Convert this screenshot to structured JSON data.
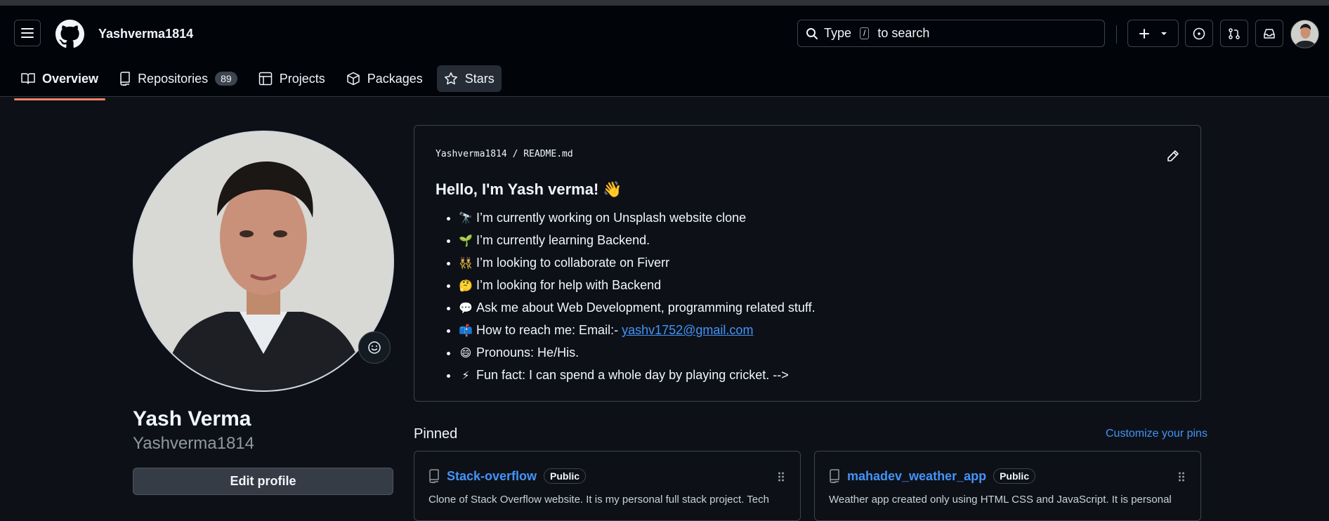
{
  "header": {
    "username": "Yashverma1814",
    "search": {
      "prefix": "Type",
      "key": "/",
      "suffix": "to search"
    }
  },
  "nav": {
    "tabs": [
      {
        "label": "Overview",
        "icon": "book-icon"
      },
      {
        "label": "Repositories",
        "icon": "repo-icon",
        "count": "89"
      },
      {
        "label": "Projects",
        "icon": "table-icon"
      },
      {
        "label": "Packages",
        "icon": "package-icon"
      },
      {
        "label": "Stars",
        "icon": "star-icon"
      }
    ]
  },
  "profile": {
    "full_name": "Yash Verma",
    "login": "Yashverma1814",
    "edit_label": "Edit profile"
  },
  "readme": {
    "path_user": "Yashverma1814",
    "path_sep": "/",
    "path_file": "README.md",
    "heading": "Hello, I'm Yash verma! 👋",
    "items": [
      {
        "emoji": "🔭",
        "text": "I’m currently working on Unsplash website clone"
      },
      {
        "emoji": "🌱",
        "text": "I’m currently learning Backend."
      },
      {
        "emoji": "👯",
        "text": "I’m looking to collaborate on Fiverr"
      },
      {
        "emoji": "🤔",
        "text": "I’m looking for help with Backend"
      },
      {
        "emoji": "💬",
        "text": "Ask me about Web Development, programming related stuff."
      },
      {
        "emoji": "📫",
        "text": "How to reach me: Email:-",
        "link": "yashv1752@gmail.com"
      },
      {
        "emoji": "😄",
        "text": "Pronouns: He/His."
      },
      {
        "emoji": "⚡",
        "text": "Fun fact: I can spend a whole day by playing cricket. -->"
      }
    ]
  },
  "pinned": {
    "title": "Pinned",
    "customize": "Customize your pins",
    "repos": [
      {
        "name": "Stack-overflow",
        "visibility": "Public",
        "description": "Clone of Stack Overflow website. It is my personal full stack project. Tech"
      },
      {
        "name": "mahadev_weather_app",
        "visibility": "Public",
        "description": "Weather app created only using HTML CSS and JavaScript. It is personal"
      }
    ]
  },
  "colors": {
    "accent": "#4493f8",
    "tab_underline": "#f78166",
    "background": "#0d1117",
    "header_bg": "#010409"
  }
}
